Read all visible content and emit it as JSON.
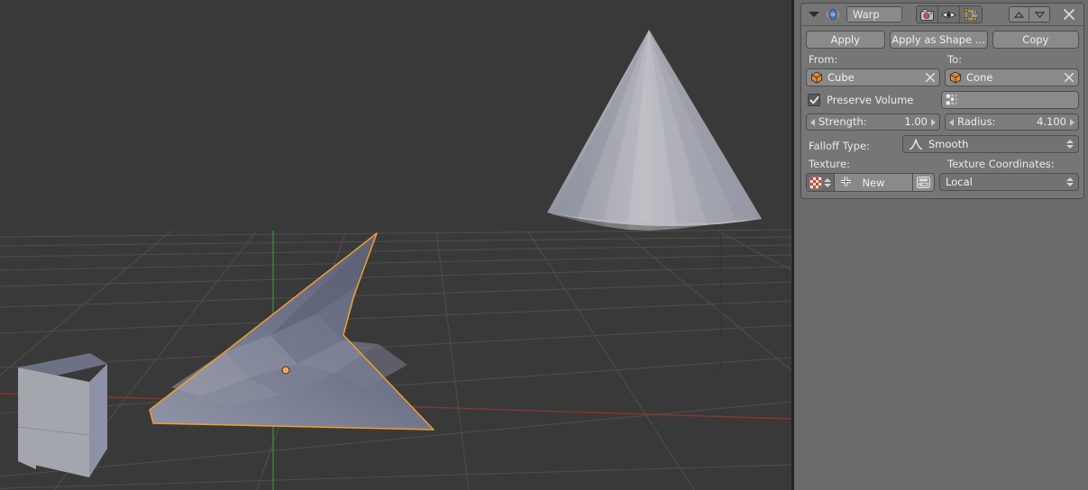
{
  "viewport": {
    "name": "3d-viewport",
    "background_color": "#393939",
    "grid_color": "#4e4e4e",
    "axis_x_color": "#8a3535",
    "axis_y_color": "#3a7a3a",
    "objects": [
      {
        "name": "Cube",
        "selected": false,
        "note": "grey shaded cube, lower-left"
      },
      {
        "name": "Cone",
        "selected": false,
        "note": "faceted grey cone, upper-right"
      },
      {
        "name": "Plane",
        "selected": true,
        "note": "warped subdivided plane with orange outline and origin dot"
      }
    ],
    "selection_outline_color": "#ed9e2e",
    "object_origin_color": "#f0a860"
  },
  "panel": {
    "modifier": {
      "icon": "warp-modifier-icon",
      "name_value": "Warp",
      "name_placeholder": "Name",
      "collapse_icon": "triangle-down-icon",
      "display_toggles": [
        {
          "label": "render",
          "icon": "camera-icon",
          "active": true
        },
        {
          "label": "viewport",
          "icon": "eye-icon",
          "active": true
        },
        {
          "label": "edit_mode",
          "icon": "edit-mode-icon",
          "active": true
        }
      ],
      "move_up_icon": "triangle-up-icon",
      "move_down_icon": "triangle-down-icon",
      "close_icon": "close-x-icon",
      "actions": [
        {
          "key": "apply",
          "label": "Apply"
        },
        {
          "key": "apply_as_shape",
          "label": "Apply as Shape …"
        },
        {
          "key": "copy",
          "label": "Copy"
        }
      ],
      "from": {
        "label": "From:",
        "object_icon": "object-mesh-icon",
        "value": "Cube",
        "clear_icon": "close-x-icon"
      },
      "to": {
        "label": "To:",
        "object_icon": "object-mesh-icon",
        "value": "Cone",
        "clear_icon": "close-x-icon"
      },
      "preserve_volume": {
        "label": "Preserve Volume",
        "checked": true,
        "check_icon": "checkmark-icon"
      },
      "vertex_group": {
        "icon": "vertex-group-icon",
        "value": "",
        "placeholder": ""
      },
      "strength": {
        "label": "Strength:",
        "value": "1.00"
      },
      "radius": {
        "label": "Radius:",
        "value": "4.100"
      },
      "falloff": {
        "label": "Falloff Type:",
        "value": "Smooth",
        "value_icon": "falloff-smooth-curve-icon",
        "expand_icon": "updown-arrows-icon"
      },
      "texture": {
        "label": "Texture:",
        "swatch_icon": "texture-checker-icon",
        "swatch_expand_icon": "updown-arrows-icon",
        "new_label": "New",
        "new_icon": "plus-icon",
        "browse_icon": "browse-texture-icon"
      },
      "texture_coordinates": {
        "label": "Texture Coordinates:",
        "value": "Local",
        "expand_icon": "updown-arrows-icon"
      }
    }
  }
}
